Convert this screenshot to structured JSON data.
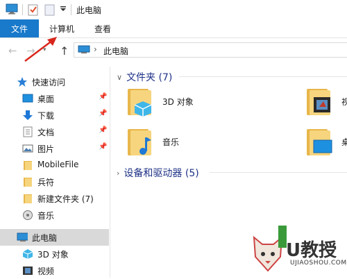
{
  "window": {
    "title": "此电脑"
  },
  "ribbon": {
    "tabs": [
      "文件",
      "计算机",
      "查看"
    ]
  },
  "address": {
    "path": "此电脑"
  },
  "nav": {
    "quick_access": "快速访问",
    "items": [
      {
        "label": "桌面",
        "icon": "desktop-icon",
        "pinned": true
      },
      {
        "label": "下载",
        "icon": "download-icon",
        "pinned": true
      },
      {
        "label": "文档",
        "icon": "document-icon",
        "pinned": true
      },
      {
        "label": "图片",
        "icon": "pictures-icon",
        "pinned": true
      },
      {
        "label": "MobileFile",
        "icon": "folder-icon",
        "pinned": false
      },
      {
        "label": "兵符",
        "icon": "folder-icon",
        "pinned": false
      },
      {
        "label": "新建文件夹 (7)",
        "icon": "folder-icon",
        "pinned": false
      },
      {
        "label": "音乐",
        "icon": "music-icon",
        "pinned": false
      }
    ],
    "this_pc": "此电脑",
    "sub_items": [
      {
        "label": "3D 对象",
        "icon": "3d-objects-icon"
      },
      {
        "label": "视频",
        "icon": "video-icon"
      }
    ]
  },
  "content": {
    "folders_section": "文件夹 (7)",
    "folders": [
      "3D 对象",
      "视",
      "音乐",
      "桌"
    ],
    "devices_section": "设备和驱动器 (5)"
  },
  "watermark": {
    "brand": "U教授",
    "url": "UJIAOSHOU.COM"
  },
  "colors": {
    "accent": "#1979ca",
    "folder": "#f6d57e",
    "section": "#1e3287",
    "arrow": "#d9261c"
  }
}
